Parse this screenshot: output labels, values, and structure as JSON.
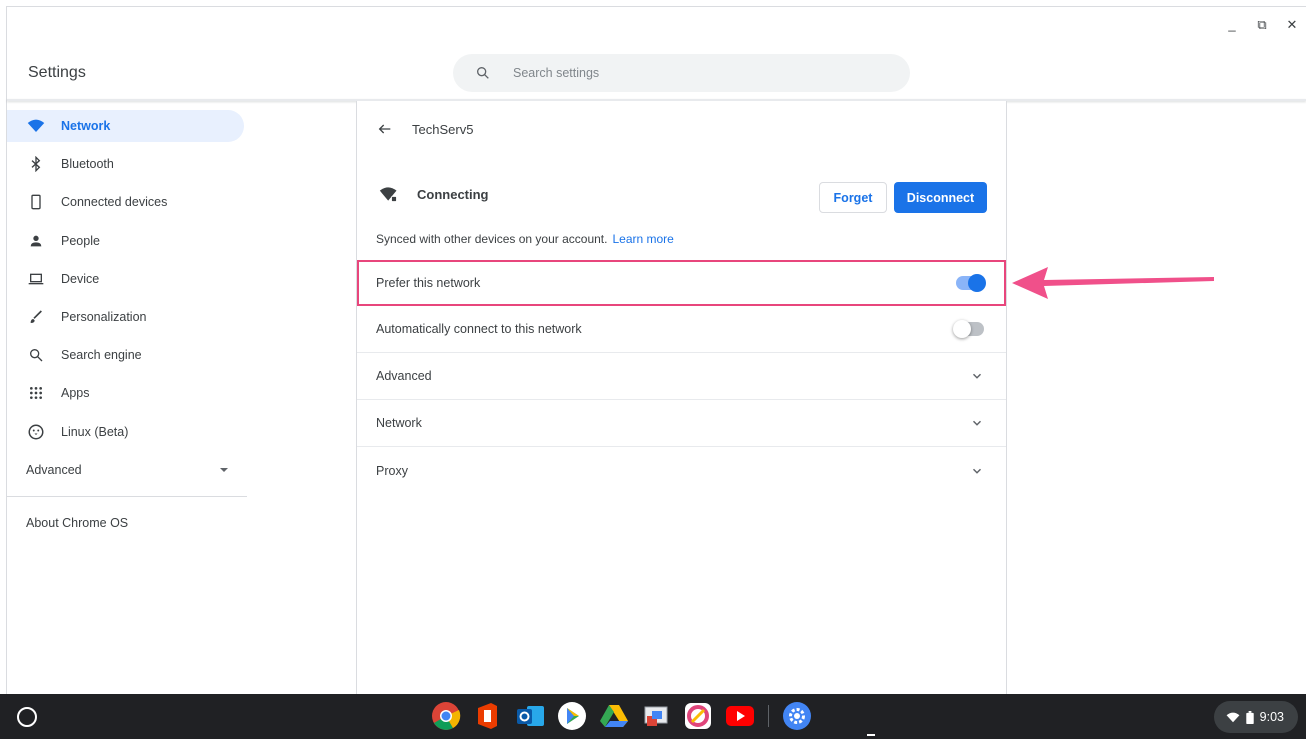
{
  "window": {
    "title": "Settings",
    "controls": {
      "minimize": "_",
      "restore": "⧉",
      "close": "✕"
    }
  },
  "search": {
    "placeholder": "Search settings"
  },
  "sidebar": {
    "items": [
      {
        "label": "Network",
        "icon": "wifi-icon",
        "active": true
      },
      {
        "label": "Bluetooth",
        "icon": "bluetooth-icon"
      },
      {
        "label": "Connected devices",
        "icon": "phone-icon"
      },
      {
        "label": "People",
        "icon": "person-icon"
      },
      {
        "label": "Device",
        "icon": "laptop-icon"
      },
      {
        "label": "Personalization",
        "icon": "brush-icon"
      },
      {
        "label": "Search engine",
        "icon": "search-icon"
      },
      {
        "label": "Apps",
        "icon": "apps-grid-icon"
      },
      {
        "label": "Linux (Beta)",
        "icon": "penguin-icon"
      }
    ],
    "advanced": "Advanced",
    "about": "About Chrome OS"
  },
  "subpage": {
    "network_name": "TechServ5",
    "status": "Connecting",
    "forget_label": "Forget",
    "disconnect_label": "Disconnect",
    "synced_text": "Synced with other devices on your account.",
    "learn_more": "Learn more",
    "rows": {
      "prefer": {
        "label": "Prefer this network",
        "on": true
      },
      "auto_connect": {
        "label": "Automatically connect to this network",
        "on": false
      },
      "advanced": "Advanced",
      "network": "Network",
      "proxy": "Proxy"
    }
  },
  "annotation": {
    "arrow_color": "#f0508a",
    "highlight_color": "#e8467c"
  },
  "shelf": {
    "apps": [
      "chrome-icon",
      "office-icon",
      "outlook-icon",
      "play-store-icon",
      "drive-icon",
      "remote-desktop-icon",
      "canvas-icon",
      "youtube-icon",
      "settings-icon"
    ],
    "time": "9:03"
  },
  "colors": {
    "accent": "#1a73e8",
    "active_bg": "#e8f0fe",
    "shelf_bg": "#202124"
  }
}
